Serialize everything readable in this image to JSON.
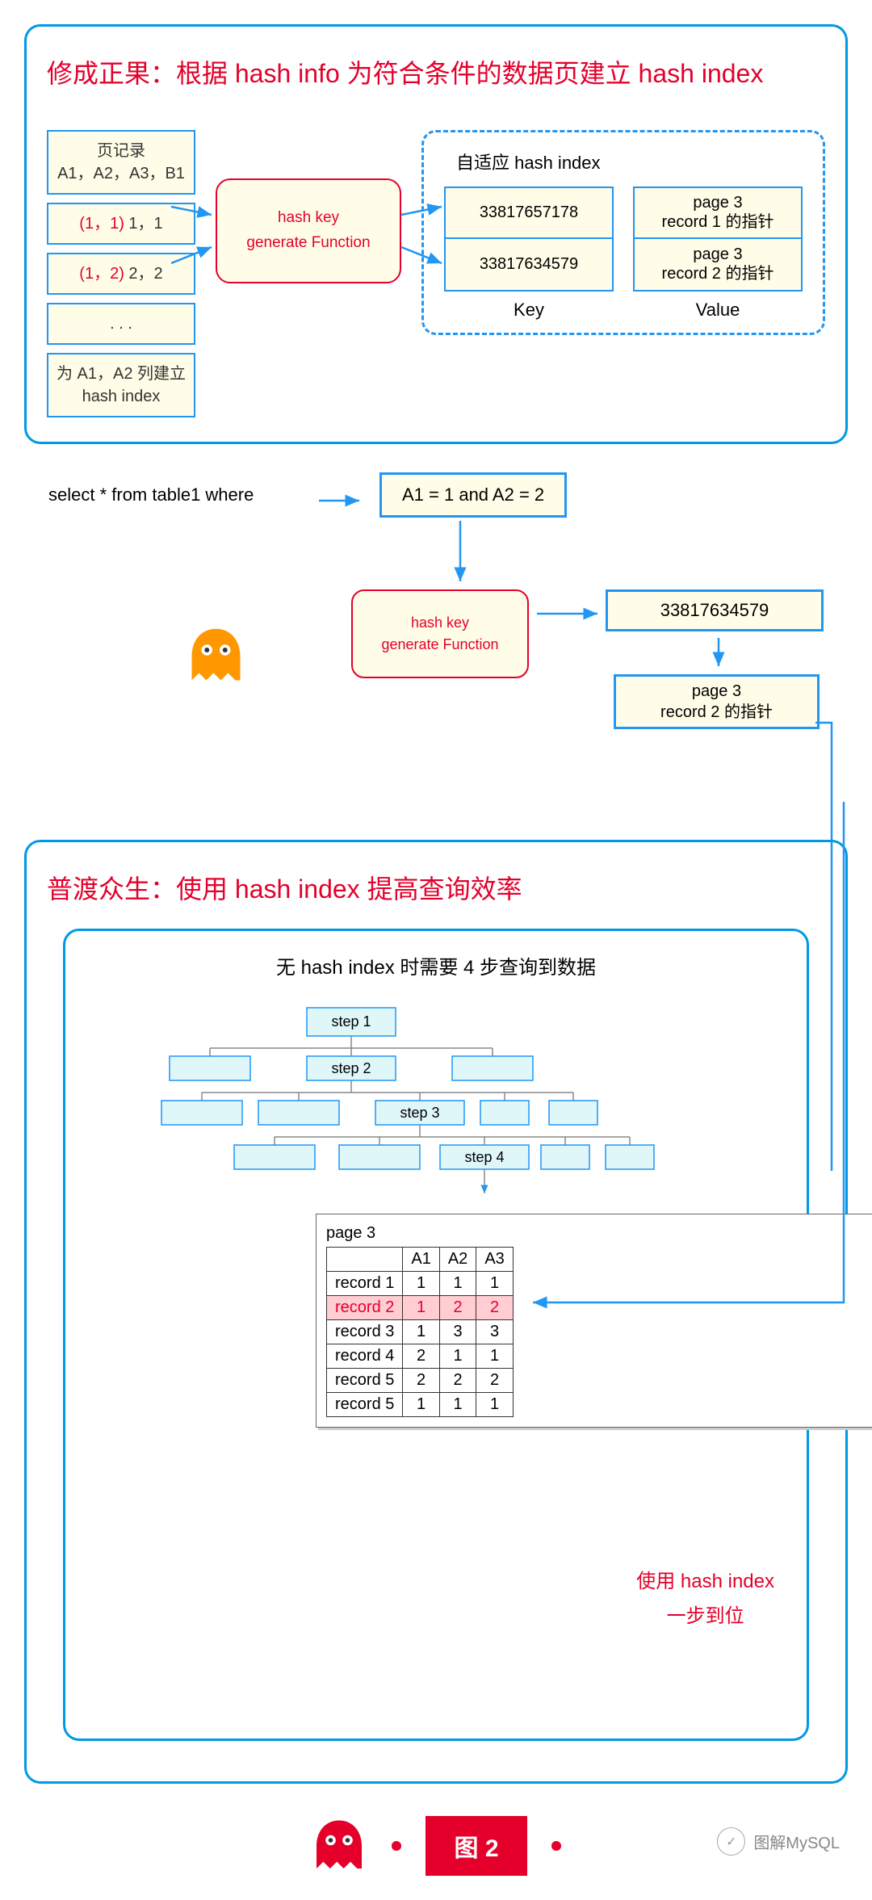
{
  "panel1": {
    "title": "修成正果：根据 hash info 为符合条件的数据页建立 hash index",
    "records": {
      "header_l1": "页记录",
      "header_l2": "A1，A2，A3，B1",
      "r1_pre": "(1，1)",
      "r1_suf": " 1，1",
      "r2_pre": "(1，2)",
      "r2_suf": " 2，2",
      "dots": ". . .",
      "footer_l1": "为 A1，A2 列建立",
      "footer_l2": "hash index"
    },
    "hashfunc_l1": "hash key",
    "hashfunc_l2": "generate Function",
    "dash_title": "自适应 hash index",
    "key1": "33817657178",
    "key2": "33817634579",
    "val1_l1": "page 3",
    "val1_l2": "record 1 的指针",
    "val2_l1": "page 3",
    "val2_l2": "record 2 的指针",
    "key_lbl": "Key",
    "val_lbl": "Value"
  },
  "mid": {
    "select": "select * from table1 where",
    "cond": "A1 = 1 and A2 = 2",
    "hashfunc_l1": "hash key",
    "hashfunc_l2": "generate Function",
    "hash_out": "33817634579",
    "ptr_l1": "page 3",
    "ptr_l2": "record 2 的指针"
  },
  "panel2": {
    "title": "普渡众生：使用 hash index 提高查询效率",
    "tree_title": "无 hash index 时需要 4 步查询到数据",
    "steps": [
      "step 1",
      "step 2",
      "step 3",
      "step 4"
    ],
    "page_title": "page 3",
    "th": [
      "",
      "A1",
      "A2",
      "A3"
    ],
    "rows": [
      [
        "record 1",
        "1",
        "1",
        "1"
      ],
      [
        "record 2",
        "1",
        "2",
        "2"
      ],
      [
        "record 3",
        "1",
        "3",
        "3"
      ],
      [
        "record 4",
        "2",
        "1",
        "1"
      ],
      [
        "record 5",
        "2",
        "2",
        "2"
      ],
      [
        "record 5",
        "1",
        "1",
        "1"
      ]
    ],
    "hl_row": 1,
    "note_l1": "使用 hash index",
    "note_l2": "一步到位"
  },
  "bottom": {
    "fig": "图 2",
    "watermark": "图解MySQL"
  },
  "colors": {
    "blue": "#0099e5",
    "red": "#e4002b",
    "yellow": "#fffde7",
    "cyan": "#e0f7fa"
  }
}
